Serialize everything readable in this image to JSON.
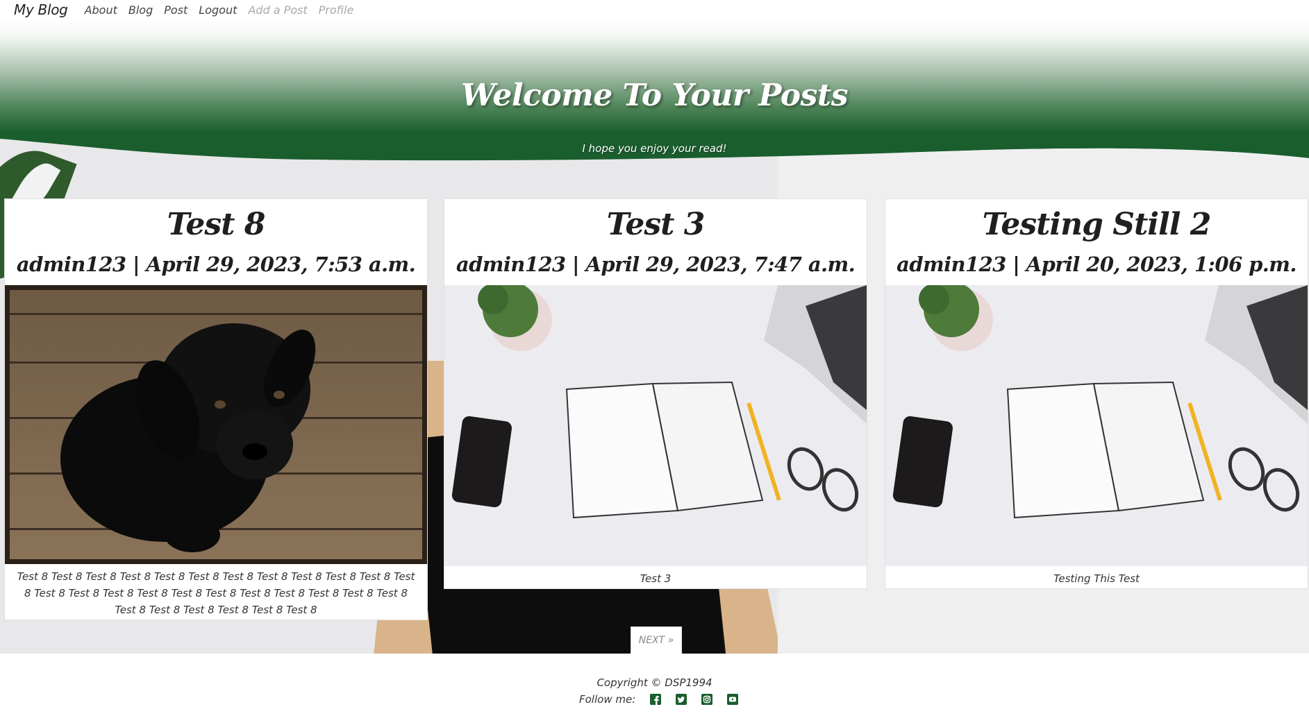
{
  "nav": {
    "brand": "My Blog",
    "links": [
      {
        "label": "About"
      },
      {
        "label": "Blog"
      },
      {
        "label": "Post"
      },
      {
        "label": "Logout"
      },
      {
        "label": "Add a Post"
      },
      {
        "label": "Profile"
      }
    ]
  },
  "hero": {
    "title": "Welcome To Your Posts",
    "subtitle": "I hope you enjoy your read!"
  },
  "posts": [
    {
      "title": "Test 8",
      "meta": "admin123 | April 29, 2023, 7:53 a.m.",
      "excerpt": "Test 8 Test 8 Test 8 Test 8 Test 8 Test 8 Test 8 Test 8 Test 8 Test 8 Test 8 Test 8 Test 8 Test 8 Test 8 Test 8 Test 8 Test 8 Test 8 Test 8 Test 8 Test 8 Test 8 Test 8 Test 8 Test 8 Test 8 Test 8 Test 8"
    },
    {
      "title": "Test 3",
      "meta": "admin123 | April 29, 2023, 7:47 a.m.",
      "excerpt": "Test 3"
    },
    {
      "title": "Testing Still 2",
      "meta": "admin123 | April 20, 2023, 1:06 p.m.",
      "excerpt": "Testing This Test"
    }
  ],
  "pagination": {
    "next_label": "NEXT »"
  },
  "footer": {
    "copyright": "Copyright © DSP1994",
    "follow_label": "Follow me:",
    "social_icons": [
      "facebook-icon",
      "twitter-icon",
      "instagram-icon",
      "youtube-icon"
    ]
  },
  "colors": {
    "hero_green": "#1a5e2e",
    "icon_green": "#1a5e2e"
  }
}
